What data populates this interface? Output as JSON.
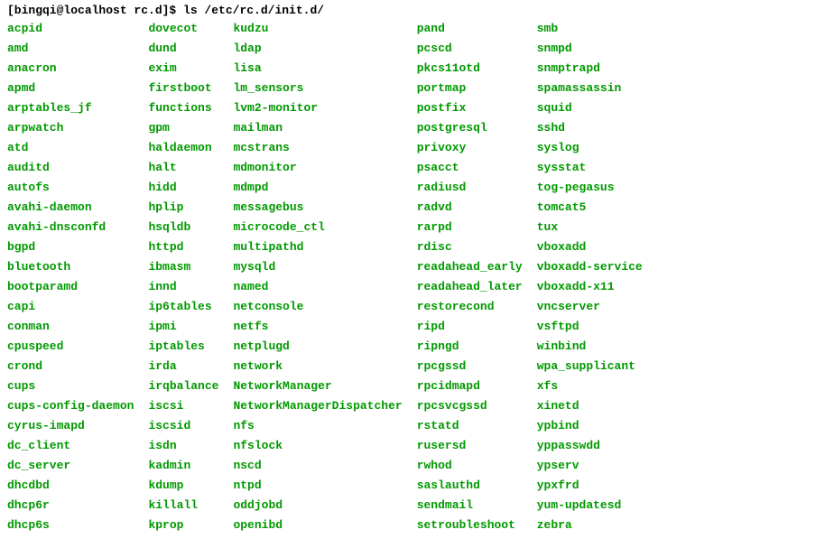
{
  "prompt": {
    "text": "[bingqi@localhost rc.d]$ ls /etc/rc.d/init.d/"
  },
  "columns": [
    [
      "acpid",
      "amd",
      "anacron",
      "apmd",
      "arptables_jf",
      "arpwatch",
      "atd",
      "auditd",
      "autofs",
      "avahi-daemon",
      "avahi-dnsconfd",
      "bgpd",
      "bluetooth",
      "bootparamd",
      "capi",
      "conman",
      "cpuspeed",
      "crond",
      "cups",
      "cups-config-daemon",
      "cyrus-imapd",
      "dc_client",
      "dc_server",
      "dhcdbd",
      "dhcp6r",
      "dhcp6s"
    ],
    [
      "dovecot",
      "dund",
      "exim",
      "firstboot",
      "functions",
      "gpm",
      "haldaemon",
      "halt",
      "hidd",
      "hplip",
      "hsqldb",
      "httpd",
      "ibmasm",
      "innd",
      "ip6tables",
      "ipmi",
      "iptables",
      "irda",
      "irqbalance",
      "iscsi",
      "iscsid",
      "isdn",
      "kadmin",
      "kdump",
      "killall",
      "kprop"
    ],
    [
      "kudzu",
      "ldap",
      "lisa",
      "lm_sensors",
      "lvm2-monitor",
      "mailman",
      "mcstrans",
      "mdmonitor",
      "mdmpd",
      "messagebus",
      "microcode_ctl",
      "multipathd",
      "mysqld",
      "named",
      "netconsole",
      "netfs",
      "netplugd",
      "network",
      "NetworkManager",
      "NetworkManagerDispatcher",
      "nfs",
      "nfslock",
      "nscd",
      "ntpd",
      "oddjobd",
      "openibd"
    ],
    [
      "pand",
      "pcscd",
      "pkcs11otd",
      "portmap",
      "postfix",
      "postgresql",
      "privoxy",
      "psacct",
      "radiusd",
      "radvd",
      "rarpd",
      "rdisc",
      "readahead_early",
      "readahead_later",
      "restorecond",
      "ripd",
      "ripngd",
      "rpcgssd",
      "rpcidmapd",
      "rpcsvcgssd",
      "rstatd",
      "rusersd",
      "rwhod",
      "saslauthd",
      "sendmail",
      "setroubleshoot"
    ],
    [
      "smb",
      "snmpd",
      "snmptrapd",
      "spamassassin",
      "squid",
      "sshd",
      "syslog",
      "sysstat",
      "tog-pegasus",
      "tomcat5",
      "tux",
      "vboxadd",
      "vboxadd-service",
      "vboxadd-x11",
      "vncserver",
      "vsftpd",
      "winbind",
      "wpa_supplicant",
      "xfs",
      "xinetd",
      "ypbind",
      "yppasswdd",
      "ypserv",
      "ypxfrd",
      "yum-updatesd",
      "zebra"
    ]
  ]
}
